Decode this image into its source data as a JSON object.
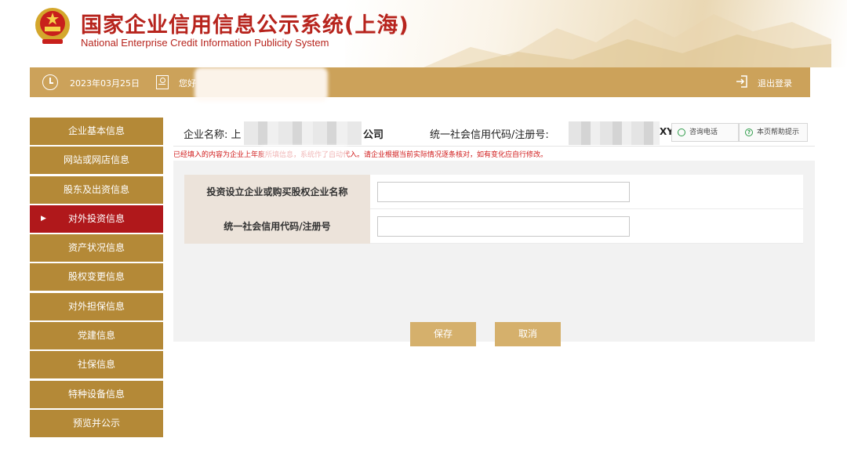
{
  "header": {
    "title_main": "国家企业信用信息公示系统",
    "title_region": "(上海)",
    "subtitle": "National Enterprise Credit Information Publicity System"
  },
  "topbar": {
    "date": "2023年03月25日",
    "greeting": "您好",
    "logout_label": "退出登录"
  },
  "sidebar": {
    "items": [
      {
        "label": "企业基本信息"
      },
      {
        "label": "网站或网店信息"
      },
      {
        "label": "股东及出资信息"
      },
      {
        "label": "对外投资信息",
        "active": true
      },
      {
        "label": "资产状况信息"
      },
      {
        "label": "股权变更信息"
      },
      {
        "label": "对外担保信息"
      },
      {
        "label": "党建信息"
      },
      {
        "label": "社保信息"
      },
      {
        "label": "特种设备信息"
      },
      {
        "label": "预览并公示"
      }
    ],
    "active_marker": "▶"
  },
  "info": {
    "company_label": "企业名称:",
    "company_prefix": "上",
    "company_suffix": "公司",
    "code_label": "统一社会信用代码/注册号:",
    "code_suffix": "XY",
    "phone_button": "咨询电话",
    "help_button": "本页帮助提示"
  },
  "notice": "已经填入的内容为企业上年度所填信息，系统作了自动代入。请企业根据当前实际情况逐条核对，如有变化应自行修改。",
  "form": {
    "fields": [
      {
        "label": "投资设立企业或购买股权企业名称",
        "value": ""
      },
      {
        "label": "统一社会信用代码/注册号",
        "value": ""
      }
    ],
    "save_label": "保存",
    "cancel_label": "取消"
  },
  "colors": {
    "brand_red": "#b7241d",
    "gold": "#cca25a",
    "sidebar_gold": "#b48937",
    "active_red": "#b0181b",
    "button_gold": "#d5b06c"
  }
}
